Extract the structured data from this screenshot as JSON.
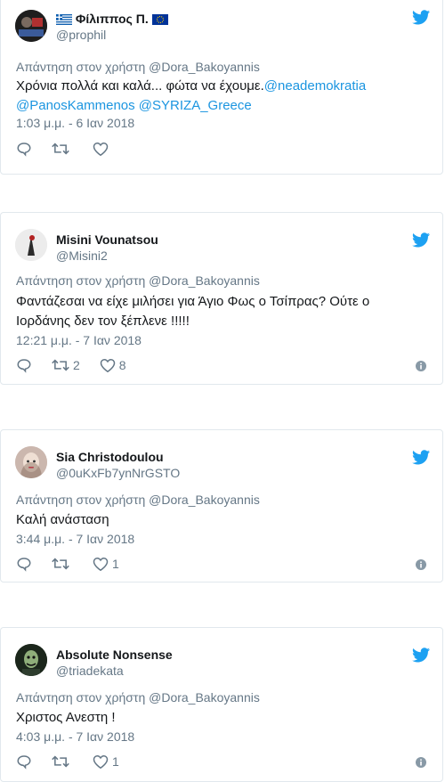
{
  "tweets": [
    {
      "name": "Φίλιππος Π.",
      "handle": "@prophil",
      "reply_prefix": "Απάντηση στον χρήστη ",
      "reply_to": "@Dora_Bakoyannis",
      "text_part1": "Χρόνια πολλά και καλά... φώτα να έχουμε.",
      "mention1": "@neademokratia",
      "mention2": "@PanosKammenos",
      "mention3": "@SYRIZA_Greece",
      "time": "1:03 μ.μ. - 6 Ιαν 2018",
      "retweets": "",
      "likes": ""
    },
    {
      "name": "Misini Vounatsou",
      "handle": "@Misini2",
      "reply_prefix": "Απάντηση στον χρήστη ",
      "reply_to": "@Dora_Bakoyannis",
      "text_line1": "Φαντάζεσαι να είχε μιλήσει για Άγιο Φως ο Τσίπρας? Ούτε ο",
      "text_line2": "Ιορδάνης δεν τον ξέπλενε !!!!!",
      "time": "12:21 μ.μ. - 7 Ιαν 2018",
      "retweets": "2",
      "likes": "8"
    },
    {
      "name": "Sia Christodoulou",
      "handle": "@0uKxFb7ynNrGSTO",
      "reply_prefix": "Απάντηση στον χρήστη ",
      "reply_to": "@Dora_Bakoyannis",
      "text": "Καλή ανάσταση",
      "time": "3:44 μ.μ. - 7 Ιαν 2018",
      "retweets": "",
      "likes": "1"
    },
    {
      "name": "Absolute Nonsense",
      "handle": "@triadekata",
      "reply_prefix": "Απάντηση στον χρήστη ",
      "reply_to": "@Dora_Bakoyannis",
      "text": "Χριστος Ανεστη !",
      "time": "4:03 μ.μ. - 7 Ιαν 2018",
      "retweets": "",
      "likes": "1"
    }
  ],
  "colors": {
    "link": "#1b95e0",
    "secondary": "#657786",
    "border": "#e1e8ed",
    "twitter_blue": "#1da1f2"
  },
  "icons": [
    "twitter-bird-icon",
    "reply-icon",
    "retweet-icon",
    "heart-icon",
    "info-icon",
    "greek-flag-icon",
    "eu-flag-icon"
  ]
}
